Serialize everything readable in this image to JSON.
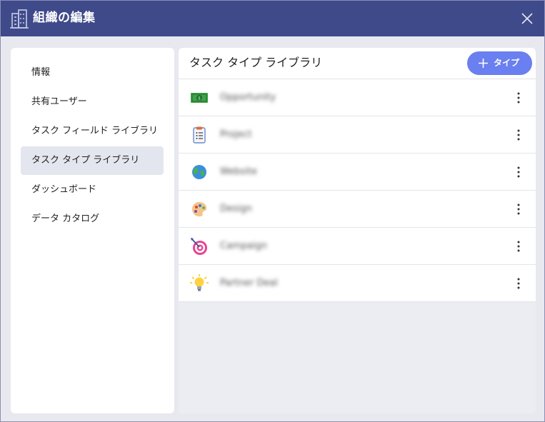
{
  "window": {
    "title": "組織の編集",
    "title_icon": "building-icon",
    "close_icon": "close-icon"
  },
  "sidebar": {
    "items": [
      {
        "label": "情報",
        "active": false
      },
      {
        "label": "共有ユーザー",
        "active": false
      },
      {
        "label": "タスク フィールド ライブラリ",
        "active": false
      },
      {
        "label": "タスク タイプ ライブラリ",
        "active": true
      },
      {
        "label": "ダッシュボード",
        "active": false
      },
      {
        "label": "データ カタログ",
        "active": false
      }
    ]
  },
  "main": {
    "title": "タスク タイプ ライブラリ",
    "add_button_label": "タイプ",
    "add_icon": "plus-icon",
    "task_types": [
      {
        "name": "Opportunity",
        "icon": "money-icon"
      },
      {
        "name": "Project",
        "icon": "clipboard-icon"
      },
      {
        "name": "Website",
        "icon": "globe-icon"
      },
      {
        "name": "Design",
        "icon": "palette-icon"
      },
      {
        "name": "Campaign",
        "icon": "target-icon"
      },
      {
        "name": "Partner Deal",
        "icon": "lightbulb-icon"
      }
    ]
  },
  "colors": {
    "titlebar": "#3f4a8a",
    "accent": "#6a7ff0",
    "active_nav": "#e4e6ef"
  }
}
